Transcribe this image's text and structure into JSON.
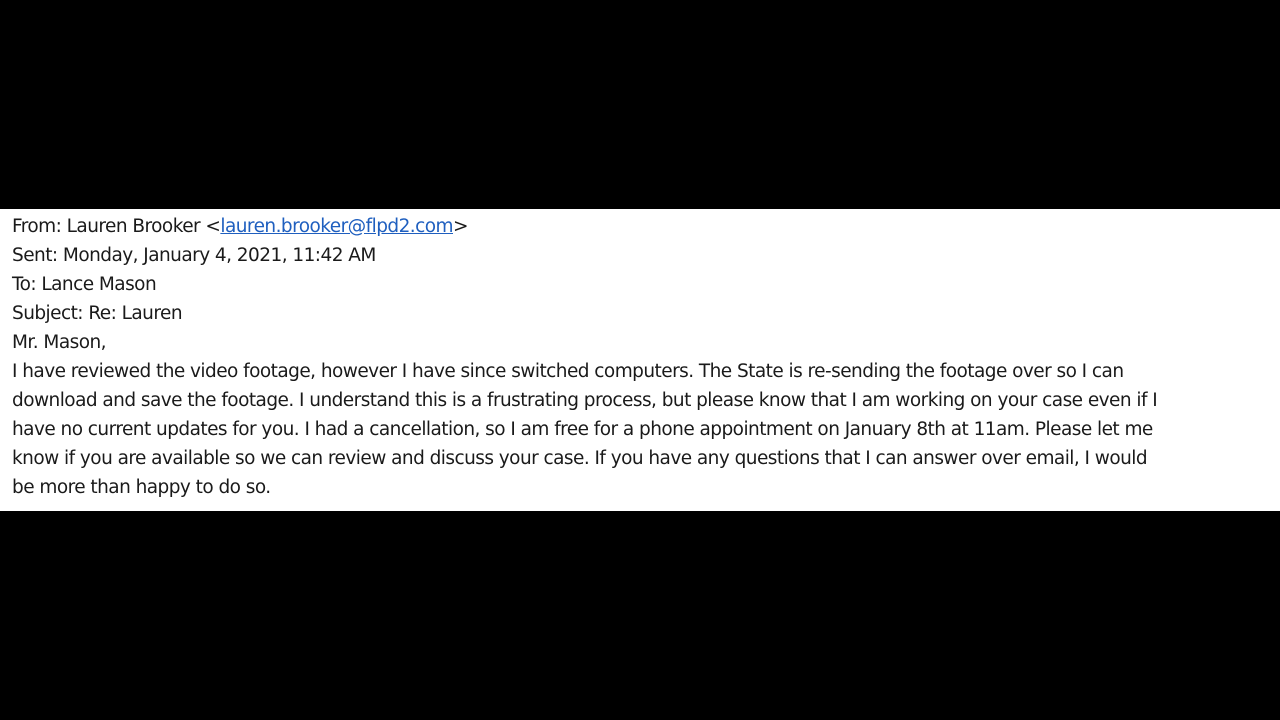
{
  "email": {
    "from_label": "From: ",
    "from_name": "Lauren Brooker ",
    "from_bracket_open": "<",
    "from_address": "lauren.brooker@flpd2.com",
    "from_bracket_close": ">",
    "sent": "Sent: Monday, January 4, 2021, 11:42 AM",
    "to": "To: Lance Mason",
    "subject": "Subject: Re: Lauren",
    "greeting": "Mr. Mason,",
    "body_lines": [
      "I have reviewed the video footage, however I have since switched computers. The State is re-sending the footage over so I can",
      "download and save the footage. I understand this is a frustrating process, but please know that I am working on your case even if I",
      "have no current updates for you. I had a cancellation, so I am free for a phone appointment on January 8th at 11am. Please let me",
      "know if you are available so we can review and discuss your case. If you have any questions that I can answer over email, I would",
      "be more than happy to do so."
    ]
  },
  "colors": {
    "background": "#000000",
    "panel": "#ffffff",
    "text": "#1a1a1a",
    "link": "#1f5fbf"
  }
}
